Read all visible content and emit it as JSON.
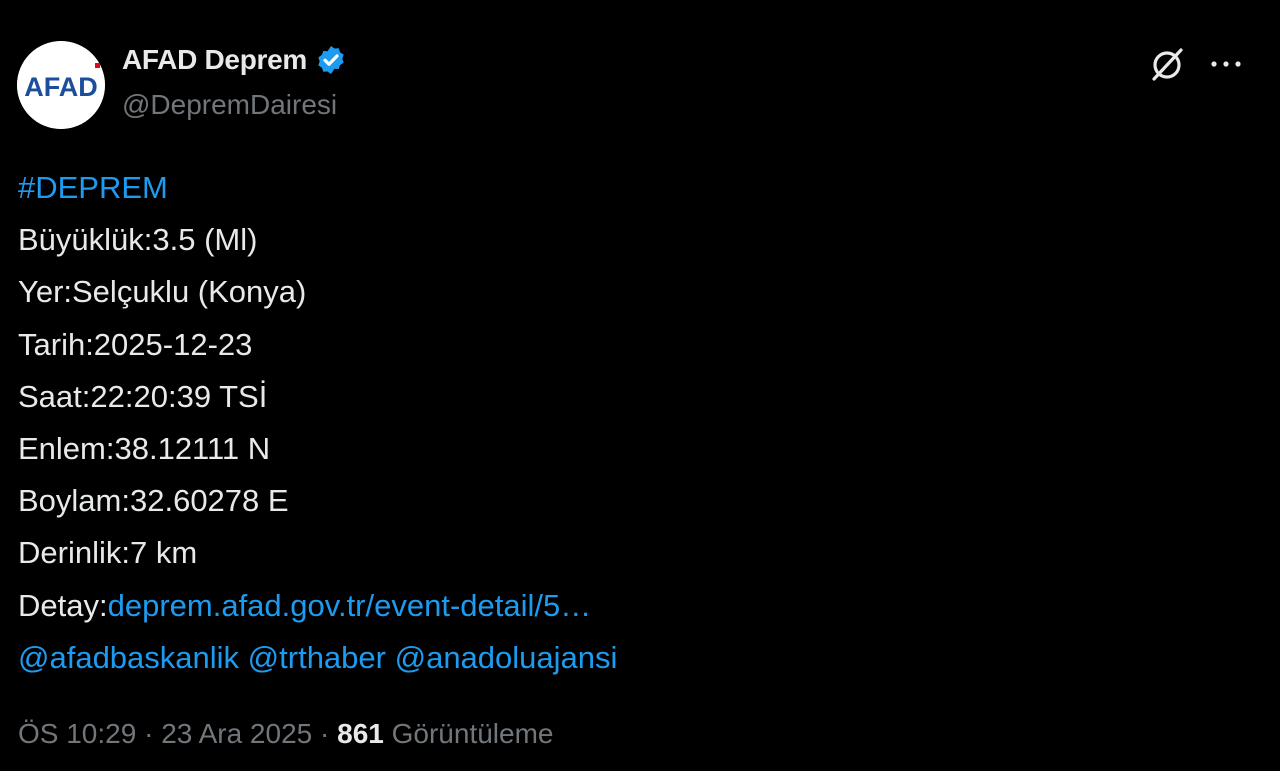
{
  "header": {
    "avatar_text": "AFAD",
    "display_name": "AFAD Deprem",
    "handle": "@DepremDairesi",
    "verified_icon": "verified-badge-icon",
    "grok_icon": "grok-icon",
    "more_icon": "more-options-icon"
  },
  "body": {
    "hashtag": "#DEPREM",
    "lines": [
      "Büyüklük:3.5 (Ml)",
      "Yer:Selçuklu (Konya)",
      "Tarih:2025-12-23",
      "Saat:22:20:39 TSİ",
      "Enlem:38.12111 N",
      "Boylam:32.60278 E",
      "Derinlik:7 km"
    ],
    "detail_label": "Detay:",
    "detail_link": "deprem.afad.gov.tr/event-detail/5…",
    "mentions": [
      "@afadbaskanlik",
      "@trthaber",
      "@anadoluajansi"
    ]
  },
  "meta": {
    "time": "ÖS 10:29",
    "separator": " · ",
    "date": "23 Ara 2025",
    "views_count": "861",
    "views_label": "Görüntüleme"
  },
  "colors": {
    "background": "#000000",
    "text": "#e7e9ea",
    "muted": "#71767b",
    "link": "#1d9bf0",
    "brand_blue": "#1b4e9b",
    "brand_red": "#e30613"
  }
}
